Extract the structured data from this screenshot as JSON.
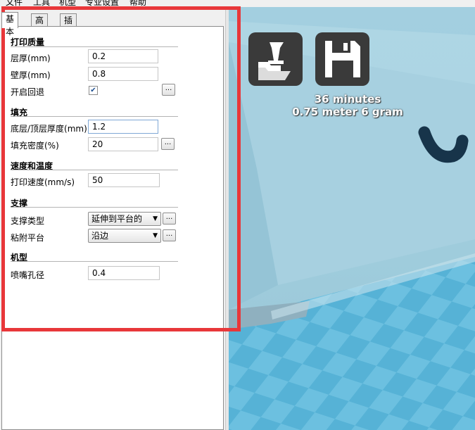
{
  "menu": [
    "文件",
    "工具",
    "机型",
    "专业设置",
    "帮助"
  ],
  "tabs": [
    "基本",
    "高级",
    "插件"
  ],
  "sections": {
    "quality": {
      "title": "打印质量",
      "layer_height": {
        "label": "层厚(mm)",
        "value": "0.2"
      },
      "shell_thickness": {
        "label": "壁厚(mm)",
        "value": "0.8"
      },
      "retraction": {
        "label": "开启回退",
        "checked": true
      }
    },
    "fill": {
      "title": "填充",
      "bottom_top": {
        "label": "底层/顶层厚度(mm)",
        "value": "1.2"
      },
      "density": {
        "label": "填充密度(%)",
        "value": "20"
      }
    },
    "speed": {
      "title": "速度和温度",
      "print_speed": {
        "label": "打印速度(mm/s)",
        "value": "50"
      }
    },
    "support": {
      "title": "支撑",
      "support_type": {
        "label": "支撑类型",
        "value": "延伸到平台的"
      },
      "platform_adhesion": {
        "label": "粘附平台",
        "value": "沿边"
      }
    },
    "machine": {
      "title": "机型",
      "nozzle": {
        "label": "喷嘴孔径",
        "value": "0.4"
      }
    }
  },
  "dots_label": "...",
  "view": {
    "time": "36 minutes",
    "material": "0.75 meter 6 gram",
    "load_icon": "load-model-icon",
    "save_icon": "save-gcode-icon",
    "accent": "#e8373a"
  }
}
